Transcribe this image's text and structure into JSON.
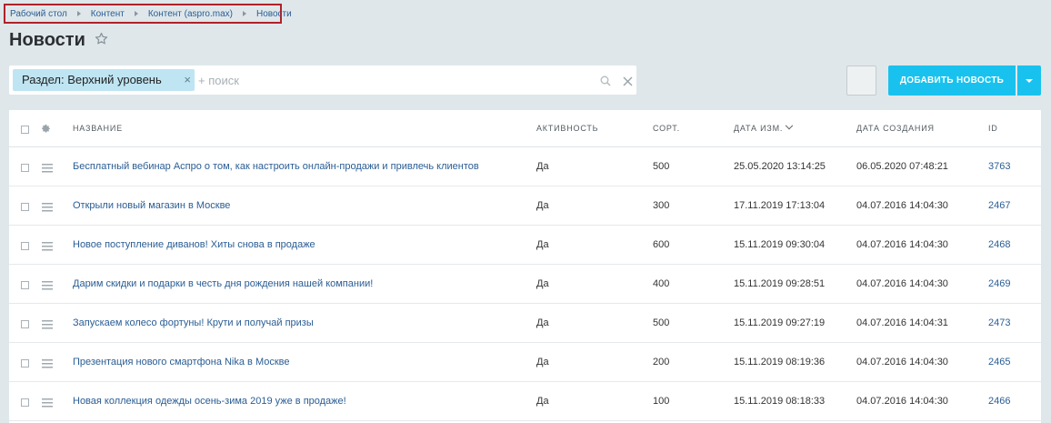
{
  "breadcrumb": [
    "Рабочий стол",
    "Контент",
    "Контент (aspro.max)",
    "Новости"
  ],
  "page": {
    "title": "Новости"
  },
  "filter": {
    "chip_label": "Раздел: Верхний уровень",
    "chip_close": "×",
    "search_placeholder": "+ поиск"
  },
  "toolbar": {
    "add_label": "ДОБАВИТЬ НОВОСТЬ"
  },
  "table": {
    "columns": {
      "name": "НАЗВАНИЕ",
      "active": "АКТИВНОСТЬ",
      "sort": "СОРТ.",
      "date_modified": "ДАТА ИЗМ.",
      "date_created": "ДАТА СОЗДАНИЯ",
      "id": "ID"
    },
    "rows": [
      {
        "name": "Бесплатный вебинар Аспро о том, как настроить онлайн-продажи и привлечь клиентов",
        "active": "Да",
        "sort": "500",
        "date_modified": "25.05.2020 13:14:25",
        "date_created": "06.05.2020 07:48:21",
        "id": "3763"
      },
      {
        "name": "Открыли новый магазин в Москве",
        "active": "Да",
        "sort": "300",
        "date_modified": "17.11.2019 17:13:04",
        "date_created": "04.07.2016 14:04:30",
        "id": "2467"
      },
      {
        "name": "Новое поступление диванов! Хиты снова в продаже",
        "active": "Да",
        "sort": "600",
        "date_modified": "15.11.2019 09:30:04",
        "date_created": "04.07.2016 14:04:30",
        "id": "2468"
      },
      {
        "name": "Дарим скидки и подарки в честь дня рождения нашей компании!",
        "active": "Да",
        "sort": "400",
        "date_modified": "15.11.2019 09:28:51",
        "date_created": "04.07.2016 14:04:30",
        "id": "2469"
      },
      {
        "name": "Запускаем колесо фортуны! Крути и получай призы",
        "active": "Да",
        "sort": "500",
        "date_modified": "15.11.2019 09:27:19",
        "date_created": "04.07.2016 14:04:31",
        "id": "2473"
      },
      {
        "name": "Презентация нового смартфона Nika в Москве",
        "active": "Да",
        "sort": "200",
        "date_modified": "15.11.2019 08:19:36",
        "date_created": "04.07.2016 14:04:30",
        "id": "2465"
      },
      {
        "name": "Новая коллекция одежды осень-зима 2019 уже в продаже!",
        "active": "Да",
        "sort": "100",
        "date_modified": "15.11.2019 08:18:33",
        "date_created": "04.07.2016 14:04:30",
        "id": "2466"
      }
    ]
  },
  "colors": {
    "accent": "#19c2ee",
    "link": "#2a5d94",
    "background": "#dfe7ea",
    "breadcrumb_border": "#b0222a"
  },
  "icons": [
    "star-icon",
    "search-icon",
    "close-icon",
    "gear-icon",
    "menu-icon",
    "chevron-down-icon"
  ]
}
